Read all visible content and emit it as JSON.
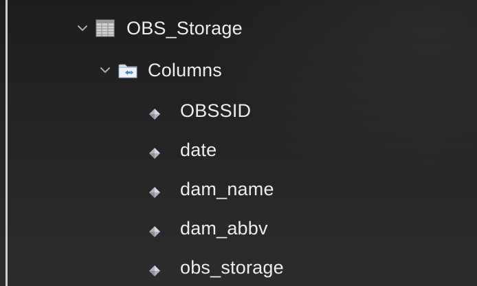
{
  "tree": {
    "table": {
      "label": "OBS_Storage",
      "icon": "table-icon",
      "expanded": true
    },
    "columns_folder": {
      "label": "Columns",
      "icon": "columns-folder-icon",
      "expanded": true
    },
    "columns": [
      {
        "label": "OBSSID",
        "icon": "column-diamond-icon"
      },
      {
        "label": "date",
        "icon": "column-diamond-icon"
      },
      {
        "label": "dam_name",
        "icon": "column-diamond-icon"
      },
      {
        "label": "dam_abbv",
        "icon": "column-diamond-icon"
      },
      {
        "label": "obs_storage",
        "icon": "column-diamond-icon"
      }
    ]
  },
  "colors": {
    "background": "#262626",
    "text": "#ececec",
    "folder_icon": "#6fa8dc",
    "column_icon": "#b9bcc4"
  }
}
